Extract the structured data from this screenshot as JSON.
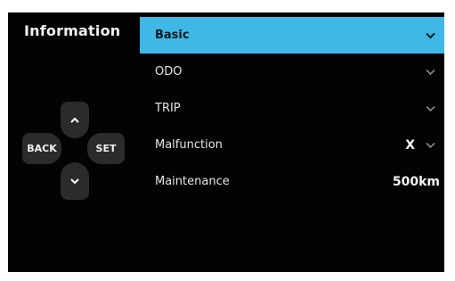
{
  "header": {
    "title": "Information"
  },
  "controls": {
    "back_label": "BACK",
    "set_label": "SET"
  },
  "menu": {
    "items": [
      {
        "label": "Basic",
        "value": "",
        "selected": true
      },
      {
        "label": "ODO",
        "value": ""
      },
      {
        "label": "TRIP",
        "value": ""
      },
      {
        "label": "Malfunction",
        "value": "X"
      },
      {
        "label": "Maintenance",
        "value": "500km"
      }
    ]
  },
  "colors": {
    "background": "#030303",
    "selected": "#3fb8e6",
    "button": "#2b2b2b"
  },
  "icons": [
    "chevron-up-icon",
    "chevron-down-icon"
  ]
}
